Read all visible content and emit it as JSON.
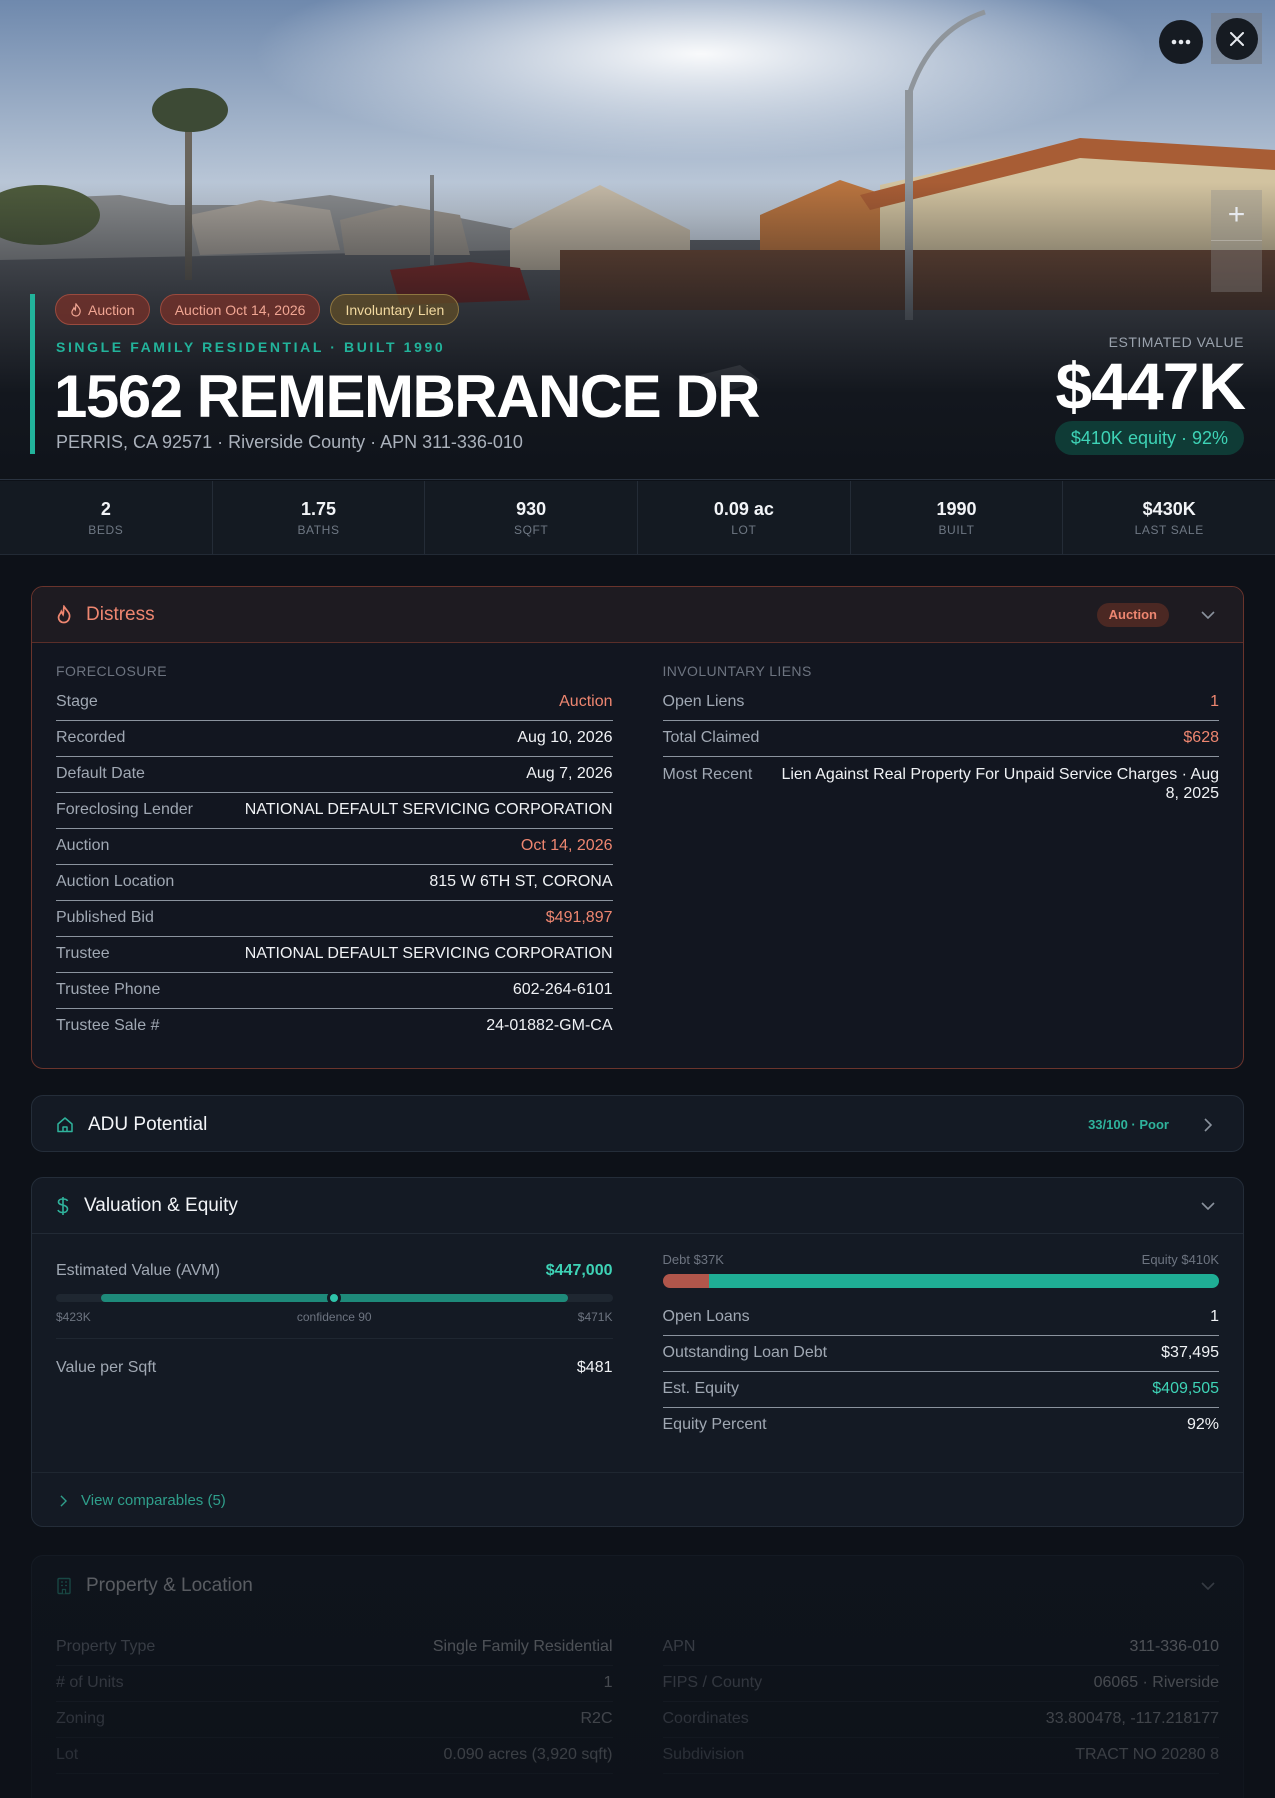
{
  "hero": {
    "badges": [
      {
        "label": "Auction",
        "icon": "flame-icon",
        "tone": "red"
      },
      {
        "label": "Auction Oct 14, 2026",
        "tone": "red"
      },
      {
        "label": "Involuntary Lien",
        "tone": "yellow"
      }
    ],
    "subtitle": "SINGLE FAMILY RESIDENTIAL · BUILT 1990",
    "title": "1562 REMEMBRANCE DR",
    "location": "PERRIS, CA 92571 · Riverside County · APN 311-336-010",
    "estimated_value_label": "ESTIMATED VALUE",
    "estimated_value": "$447K",
    "equity_pill": "$410K equity · 92%"
  },
  "stats": [
    {
      "value": "2",
      "label": "BEDS"
    },
    {
      "value": "1.75",
      "label": "BATHS"
    },
    {
      "value": "930",
      "label": "SQFT"
    },
    {
      "value": "0.09 ac",
      "label": "LOT"
    },
    {
      "value": "1990",
      "label": "BUILT"
    },
    {
      "value": "$430K",
      "label": "LAST SALE"
    }
  ],
  "distress": {
    "title": "Distress",
    "badge": "Auction",
    "foreclosure": {
      "heading": "FORECLOSURE",
      "rows": [
        {
          "k": "Stage",
          "v": "Auction",
          "tone": "red"
        },
        {
          "k": "Recorded",
          "v": "Aug 10, 2026"
        },
        {
          "k": "Default Date",
          "v": "Aug 7, 2026"
        },
        {
          "k": "Foreclosing Lender",
          "v": "NATIONAL DEFAULT SERVICING CORPORATION"
        },
        {
          "k": "Auction",
          "v": "Oct 14, 2026",
          "tone": "red"
        },
        {
          "k": "Auction Location",
          "v": "815 W 6TH ST, CORONA"
        },
        {
          "k": "Published Bid",
          "v": "$491,897",
          "tone": "red"
        },
        {
          "k": "Trustee",
          "v": "NATIONAL DEFAULT SERVICING CORPORATION"
        },
        {
          "k": "Trustee Phone",
          "v": "602-264-6101"
        },
        {
          "k": "Trustee Sale #",
          "v": "24-01882-GM-CA"
        }
      ]
    },
    "liens": {
      "heading": "INVOLUNTARY LIENS",
      "rows": [
        {
          "k": "Open Liens",
          "v": "1",
          "tone": "red"
        },
        {
          "k": "Total Claimed",
          "v": "$628",
          "tone": "red"
        },
        {
          "k": "Most Recent",
          "v": "Lien Against Real Property For Unpaid Service Charges · Aug 8, 2025",
          "tall": true
        }
      ]
    }
  },
  "adu": {
    "title": "ADU Potential",
    "score": "33/100 · Poor"
  },
  "valuation": {
    "title": "Valuation & Equity",
    "avm_label": "Estimated Value (AVM)",
    "avm_value": "$447,000",
    "range_low": "$423K",
    "range_confidence": "confidence 90",
    "range_high": "$471K",
    "range_fill_start": 0.08,
    "range_fill_end": 0.92,
    "range_marker": 0.5,
    "vps_label": "Value per Sqft",
    "vps_value": "$481",
    "debt_label": "Debt $37K",
    "equity_label": "Equity $410K",
    "debt_fraction": 0.084,
    "rows": [
      {
        "k": "Open Loans",
        "v": "1"
      },
      {
        "k": "Outstanding Loan Debt",
        "v": "$37,495"
      },
      {
        "k": "Est. Equity",
        "v": "$409,505",
        "tone": "green"
      },
      {
        "k": "Equity Percent",
        "v": "92%"
      }
    ],
    "comparables_link": "View comparables (5)"
  },
  "property": {
    "title": "Property & Location",
    "left": [
      {
        "k": "Property Type",
        "v": "Single Family Residential"
      },
      {
        "k": "# of Units",
        "v": "1"
      },
      {
        "k": "Zoning",
        "v": "R2C"
      },
      {
        "k": "Lot",
        "v": "0.090 acres (3,920 sqft)"
      }
    ],
    "right": [
      {
        "k": "APN",
        "v": "311-336-010"
      },
      {
        "k": "FIPS / County",
        "v": "06065 · Riverside"
      },
      {
        "k": "Coordinates",
        "v": "33.800478, -117.218177"
      },
      {
        "k": "Subdivision",
        "v": "TRACT NO 20280 8"
      }
    ]
  },
  "colors": {
    "accent": "#22b39b",
    "distress": "#ee8670",
    "background": "#0d1118"
  }
}
